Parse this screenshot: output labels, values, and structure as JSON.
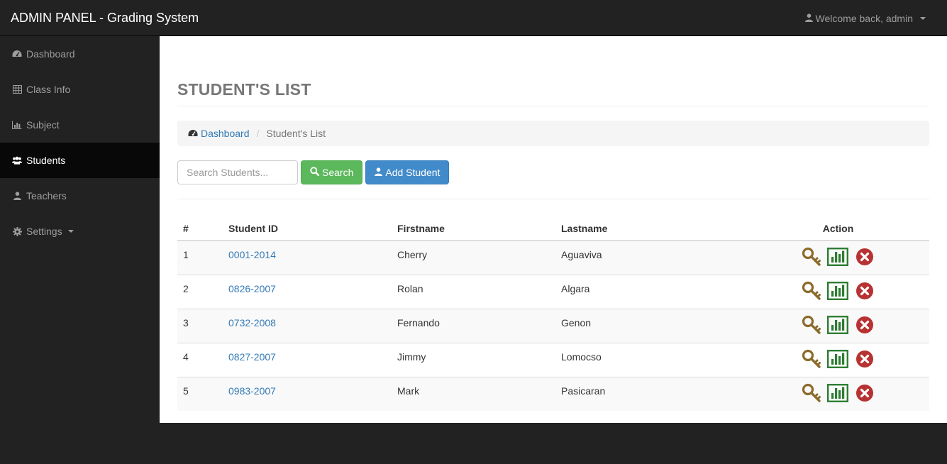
{
  "app": {
    "brand": "ADMIN PANEL - Grading System",
    "user_menu": "Welcome back, admin"
  },
  "sidebar": {
    "items": [
      {
        "label": "Dashboard",
        "icon": "dashboard-icon"
      },
      {
        "label": "Class Info",
        "icon": "table-icon"
      },
      {
        "label": "Subject",
        "icon": "bar-chart-icon"
      },
      {
        "label": "Students",
        "icon": "users-icon",
        "active": true
      },
      {
        "label": "Teachers",
        "icon": "user-icon"
      },
      {
        "label": "Settings",
        "icon": "gear-icon"
      }
    ]
  },
  "main": {
    "title": "STUDENT'S LIST",
    "breadcrumb": {
      "home": "Dashboard",
      "current": "Student's List"
    },
    "search": {
      "placeholder": "Search Students...",
      "value": ""
    },
    "search_button": "Search",
    "add_button": "Add Student"
  },
  "table": {
    "headers": [
      "#",
      "Student ID",
      "Firstname",
      "Lastname",
      "Action"
    ],
    "rows": [
      {
        "num": "1",
        "id": "0001-2014",
        "first": "Cherry",
        "last": "Aguaviva"
      },
      {
        "num": "2",
        "id": "0826-2007",
        "first": "Rolan",
        "last": "Algara"
      },
      {
        "num": "3",
        "id": "0732-2008",
        "first": "Fernando",
        "last": "Genon"
      },
      {
        "num": "4",
        "id": "0827-2007",
        "first": "Jimmy",
        "last": "Lomocso"
      },
      {
        "num": "5",
        "id": "0983-2007",
        "first": "Mark",
        "last": "Pasicaran"
      }
    ]
  },
  "colors": {
    "topbar": "#222222",
    "active_nav": "#080808",
    "link": "#337ab7",
    "search_button": "#5cb85c",
    "add_button": "#428bca",
    "key_icon": "#8b6b2a",
    "chart_icon": "#2e7d32",
    "delete_icon": "#b83232"
  }
}
